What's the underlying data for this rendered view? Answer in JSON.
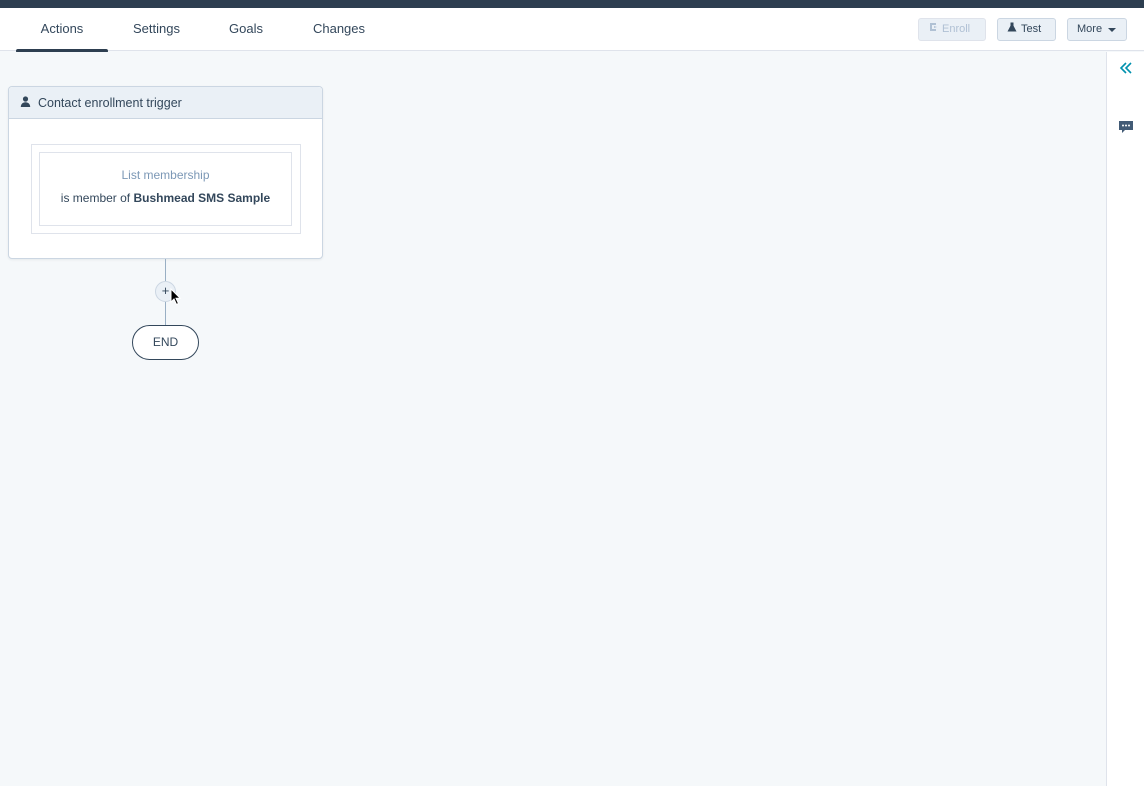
{
  "tabs": [
    {
      "label": "Actions",
      "active": true
    },
    {
      "label": "Settings",
      "active": false
    },
    {
      "label": "Goals",
      "active": false
    },
    {
      "label": "Changes",
      "active": false
    }
  ],
  "toolbar": {
    "enroll_label": "Enroll",
    "test_label": "Test",
    "more_label": "More"
  },
  "trigger": {
    "title": "Contact enrollment trigger",
    "filter_type": "List membership",
    "filter_prefix": "is member of",
    "filter_value": "Bushmead SMS Sample"
  },
  "flow": {
    "add_symbol": "+",
    "end_label": "END"
  },
  "colors": {
    "accent": "#0091ae",
    "topbar": "#2d3e50",
    "canvas": "#f5f8fa"
  },
  "icons": {
    "collapse": "double-chevron-left-icon",
    "chat": "chat-bubble-icon",
    "contact": "person-icon",
    "enroll": "enroll-icon",
    "test": "flask-icon"
  }
}
